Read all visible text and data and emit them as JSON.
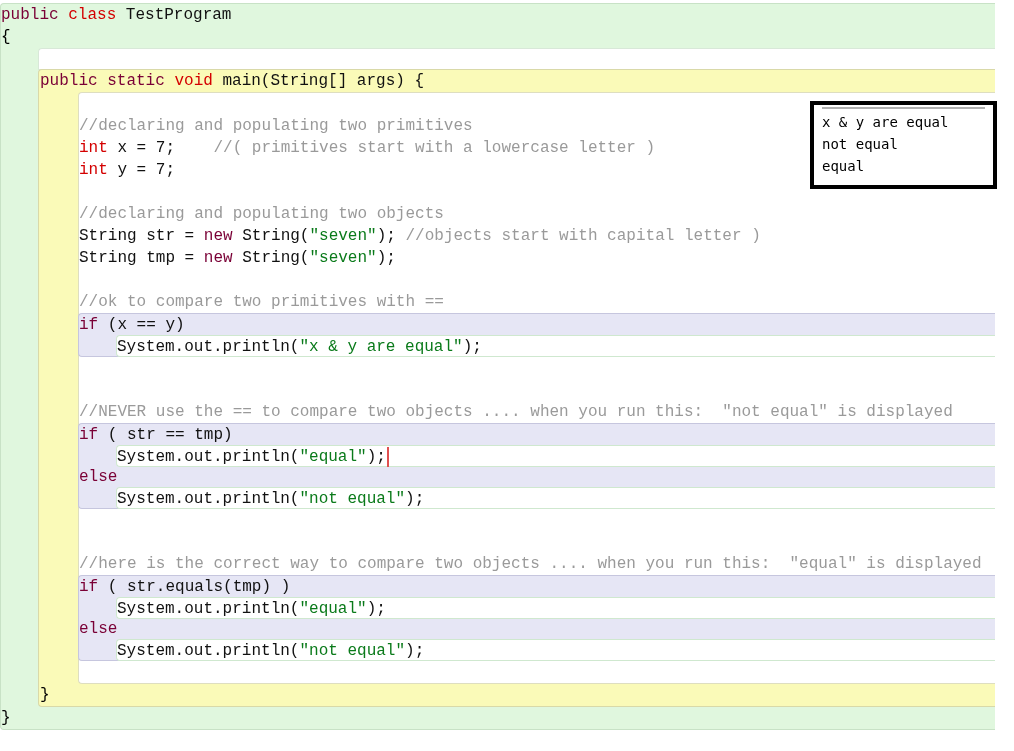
{
  "editor": {
    "class_header": [
      {
        "kind": "kw",
        "text": "public "
      },
      {
        "kind": "type",
        "text": "class "
      },
      {
        "kind": "plain",
        "text": "TestProgram"
      }
    ],
    "class_open": "{",
    "method": {
      "header": [
        {
          "kind": "kw",
          "text": "public static "
        },
        {
          "kind": "type",
          "text": "void "
        },
        {
          "kind": "plain",
          "text": "main(String[] args) {"
        }
      ],
      "body": [
        {
          "kind": "blank"
        },
        {
          "kind": "line",
          "tokens": [
            {
              "kind": "comment",
              "text": "//declaring and populating two primitives"
            }
          ]
        },
        {
          "kind": "line",
          "tokens": [
            {
              "kind": "type",
              "text": "int "
            },
            {
              "kind": "plain",
              "text": "x = 7;    "
            },
            {
              "kind": "comment",
              "text": "//( primitives start with a lowercase letter )"
            }
          ]
        },
        {
          "kind": "line",
          "tokens": [
            {
              "kind": "type",
              "text": "int "
            },
            {
              "kind": "plain",
              "text": "y = 7;"
            }
          ]
        },
        {
          "kind": "blank"
        },
        {
          "kind": "line",
          "tokens": [
            {
              "kind": "comment",
              "text": "//declaring and populating two objects"
            }
          ]
        },
        {
          "kind": "line",
          "tokens": [
            {
              "kind": "plain",
              "text": "String str = "
            },
            {
              "kind": "kw",
              "text": "new "
            },
            {
              "kind": "plain",
              "text": "String("
            },
            {
              "kind": "string",
              "text": "\"seven\""
            },
            {
              "kind": "plain",
              "text": "); "
            },
            {
              "kind": "comment",
              "text": "//objects start with capital letter )"
            }
          ]
        },
        {
          "kind": "line",
          "tokens": [
            {
              "kind": "plain",
              "text": "String tmp = "
            },
            {
              "kind": "kw",
              "text": "new "
            },
            {
              "kind": "plain",
              "text": "String("
            },
            {
              "kind": "string",
              "text": "\"seven\""
            },
            {
              "kind": "plain",
              "text": ");"
            }
          ]
        },
        {
          "kind": "blank"
        },
        {
          "kind": "line",
          "tokens": [
            {
              "kind": "comment",
              "text": "//ok to compare two primitives with =="
            }
          ]
        },
        {
          "kind": "if",
          "rows": [
            {
              "kind": "cond",
              "tokens": [
                {
                  "kind": "kw",
                  "text": "if "
                },
                {
                  "kind": "plain",
                  "text": "(x == y)"
                }
              ]
            },
            {
              "kind": "stmt",
              "tokens": [
                {
                  "kind": "plain",
                  "text": "System.out.println("
                },
                {
                  "kind": "string",
                  "text": "\"x & y are equal\""
                },
                {
                  "kind": "plain",
                  "text": ");"
                }
              ]
            }
          ]
        },
        {
          "kind": "blank"
        },
        {
          "kind": "blank"
        },
        {
          "kind": "line",
          "tokens": [
            {
              "kind": "comment",
              "text": "//NEVER use the == to compare two objects .... when you run this:  \"not equal\" is displayed"
            }
          ]
        },
        {
          "kind": "if",
          "rows": [
            {
              "kind": "cond",
              "tokens": [
                {
                  "kind": "kw",
                  "text": "if "
                },
                {
                  "kind": "plain",
                  "text": "( str == tmp)"
                }
              ]
            },
            {
              "kind": "stmt",
              "cursor": true,
              "tokens": [
                {
                  "kind": "plain",
                  "text": "System.out.println("
                },
                {
                  "kind": "string",
                  "text": "\"equal\""
                },
                {
                  "kind": "plain",
                  "text": ");"
                }
              ]
            },
            {
              "kind": "cond",
              "tokens": [
                {
                  "kind": "kw",
                  "text": "else"
                }
              ]
            },
            {
              "kind": "stmt",
              "tokens": [
                {
                  "kind": "plain",
                  "text": "System.out.println("
                },
                {
                  "kind": "string",
                  "text": "\"not equal\""
                },
                {
                  "kind": "plain",
                  "text": ");"
                }
              ]
            }
          ]
        },
        {
          "kind": "blank"
        },
        {
          "kind": "blank"
        },
        {
          "kind": "line",
          "tokens": [
            {
              "kind": "comment",
              "text": "//here is the correct way to compare two objects .... when you run this:  \"equal\" is displayed"
            }
          ]
        },
        {
          "kind": "if",
          "rows": [
            {
              "kind": "cond",
              "tokens": [
                {
                  "kind": "kw",
                  "text": "if "
                },
                {
                  "kind": "plain",
                  "text": "( str.equals(tmp) )"
                }
              ]
            },
            {
              "kind": "stmt",
              "tokens": [
                {
                  "kind": "plain",
                  "text": "System.out.println("
                },
                {
                  "kind": "string",
                  "text": "\"equal\""
                },
                {
                  "kind": "plain",
                  "text": ");"
                }
              ]
            },
            {
              "kind": "cond",
              "tokens": [
                {
                  "kind": "kw",
                  "text": "else"
                }
              ]
            },
            {
              "kind": "stmt",
              "tokens": [
                {
                  "kind": "plain",
                  "text": "System.out.println("
                },
                {
                  "kind": "string",
                  "text": "\"not equal\""
                },
                {
                  "kind": "plain",
                  "text": ");"
                }
              ]
            }
          ]
        },
        {
          "kind": "blank"
        }
      ],
      "close": "}"
    },
    "class_close": "}"
  },
  "output": {
    "lines": [
      "x & y are equal",
      "not equal",
      "equal"
    ]
  }
}
